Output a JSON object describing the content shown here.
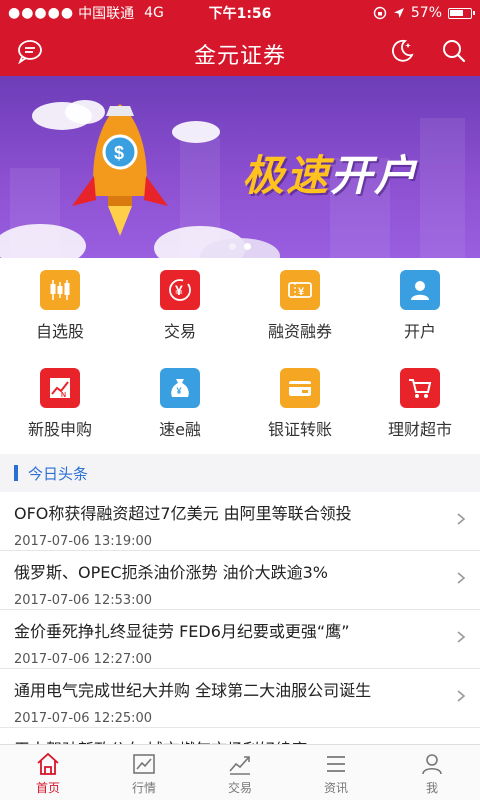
{
  "status_bar": {
    "signal": "●●●●●",
    "carrier": "中国联通",
    "network": "4G",
    "time": "下午1:56",
    "battery": "57%",
    "battery_level": 0.57
  },
  "navbar": {
    "title": "金元证券",
    "icons": [
      "message-icon",
      "night-mode-icon",
      "search-icon"
    ]
  },
  "banner": {
    "slogan_part1": "极速",
    "slogan_part2": "开户",
    "pages": 2,
    "active_page": 2
  },
  "quick_menu": [
    {
      "label": "自选股",
      "icon": "candlestick-chart-icon",
      "color": "#f5a623"
    },
    {
      "label": "交易",
      "icon": "yen-exchange-icon",
      "color": "#e8232a"
    },
    {
      "label": "融资融券",
      "icon": "ticket-yen-icon",
      "color": "#f5a623"
    },
    {
      "label": "开户",
      "icon": "user-icon",
      "color": "#3a9fe0"
    },
    {
      "label": "新股申购",
      "icon": "new-stock-chart-icon",
      "color": "#e8232a"
    },
    {
      "label": "速e融",
      "icon": "money-bag-icon",
      "color": "#3a9fe0"
    },
    {
      "label": "银证转账",
      "icon": "bank-card-icon",
      "color": "#f5a623"
    },
    {
      "label": "理财超市",
      "icon": "shopping-cart-icon",
      "color": "#e8232a"
    }
  ],
  "news_section": {
    "title": "今日头条",
    "items": [
      {
        "headline": "OFO称获得融资超过7亿美元 由阿里等联合领投",
        "date": "2017-07-06 13:19:00"
      },
      {
        "headline": "俄罗斯、OPEC扼杀油价涨势 油价大跌逾3%",
        "date": "2017-07-06 12:53:00"
      },
      {
        "headline": "金价垂死挣扎终显徒劳 FED6月纪要或更强“鹰”",
        "date": "2017-07-06 12:27:00"
      },
      {
        "headline": "通用电气完成世纪大并购 全球第二大油服公司诞生",
        "date": "2017-07-06 12:25:00"
      },
      {
        "headline": "无人驾驶新政公布 城市燃气市场利好续库",
        "date": ""
      }
    ]
  },
  "tabbar": [
    {
      "label": "首页",
      "icon": "home-icon",
      "active": true
    },
    {
      "label": "行情",
      "icon": "market-chart-icon",
      "active": false
    },
    {
      "label": "交易",
      "icon": "trade-icon",
      "active": false
    },
    {
      "label": "资讯",
      "icon": "news-list-icon",
      "active": false
    },
    {
      "label": "我",
      "icon": "profile-icon",
      "active": false
    }
  ],
  "colors": {
    "brand_red": "#d6162a",
    "accent_blue": "#2a6fd6"
  }
}
